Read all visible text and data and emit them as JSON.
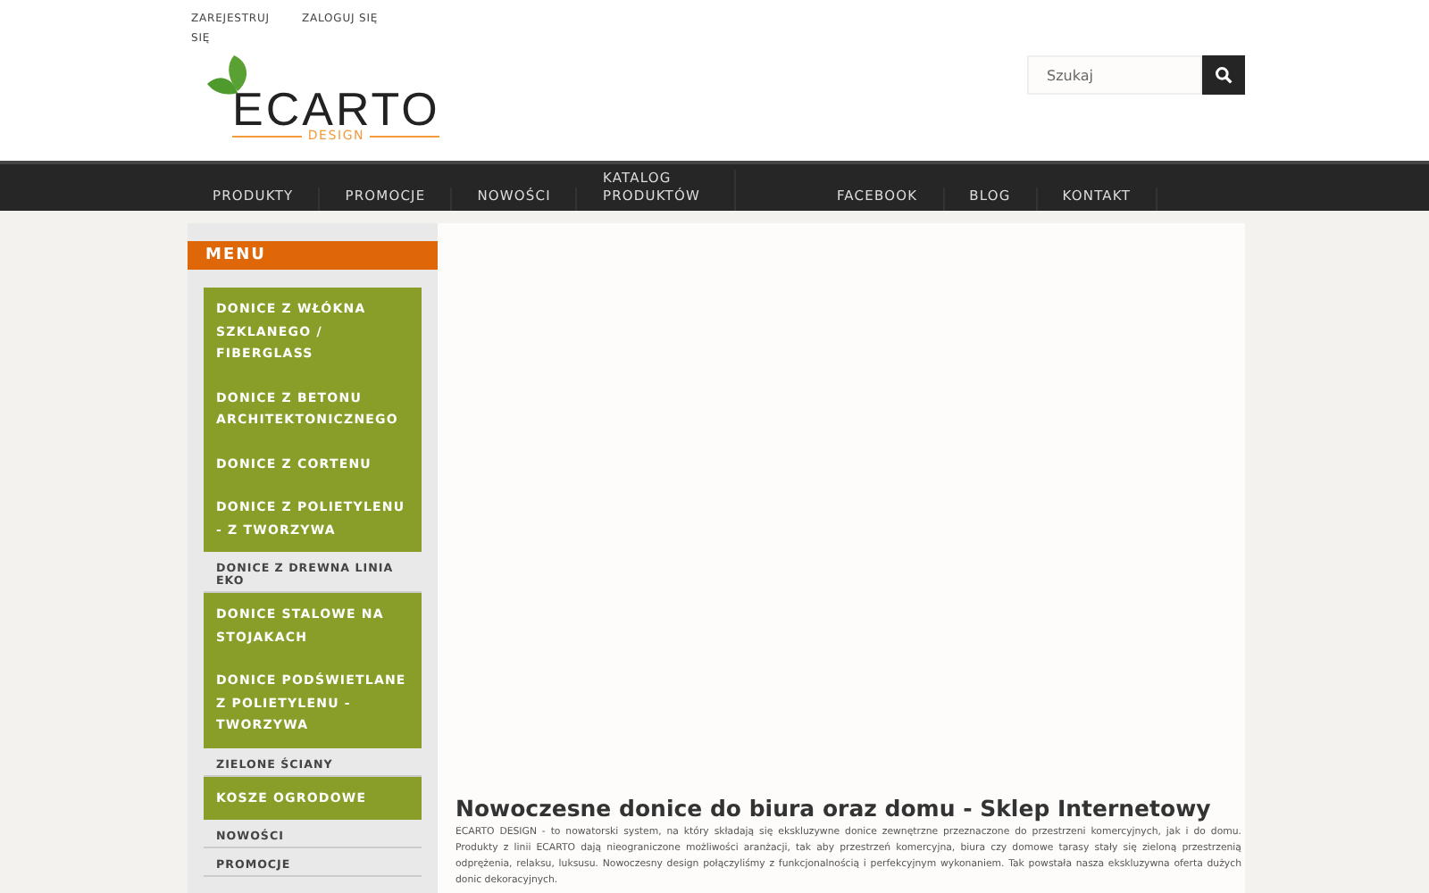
{
  "top_links": [
    "ZAREJESTRUJ SIĘ",
    "ZALOGUJ SIĘ"
  ],
  "logo": {
    "name": "ECARTO",
    "tagline": "DESIGN"
  },
  "search": {
    "placeholder": "Szukaj"
  },
  "nav": {
    "left": [
      "PRODUKTY",
      "PROMOCJE",
      "NOWOŚCI",
      "KATALOG PRODUKTÓW"
    ],
    "right": [
      "FACEBOOK",
      "BLOG",
      "KONTAKT"
    ]
  },
  "sidebar": {
    "title": "MENU",
    "items": [
      {
        "kind": "feature",
        "label": "DONICE Z WŁÓKNA SZKLANEGO / FIBERGLASS"
      },
      {
        "kind": "feature",
        "label": "DONICE Z BETONU ARCHITEKTONICZNEGO"
      },
      {
        "kind": "feature",
        "label": "DONICE Z CORTENU"
      },
      {
        "kind": "feature",
        "label": "DONICE Z POLIETYLENU - Z TWORZYWA"
      },
      {
        "kind": "plain",
        "label": "DONICE Z DREWNA LINIA EKO"
      },
      {
        "kind": "feature",
        "label": "DONICE STALOWE NA STOJAKACH"
      },
      {
        "kind": "feature",
        "label": "DONICE PODŚWIETLANE Z POLIETYLENU - TWORZYWA"
      },
      {
        "kind": "plain",
        "label": "ZIELONE ŚCIANY"
      },
      {
        "kind": "feature",
        "label": "KOSZE OGRODOWE"
      },
      {
        "kind": "plain",
        "label": "NOWOŚCI"
      },
      {
        "kind": "plain",
        "label": "PROMOCJE"
      }
    ]
  },
  "main": {
    "heading": "Nowoczesne donice do biura oraz domu - Sklep Internetowy",
    "intro": "ECARTO DESIGN - to nowatorski system, na który składają się ekskluzywne donice zewnętrzne przeznaczone do przestrzeni komercyjnych, jak i do domu. Produkty z linii ECARTO dają nieograniczone możliwości aranżacji, tak aby przestrzeń komercyjna, biura czy domowe tarasy stały się zieloną przestrzenią odprężenia, relaksu, luksusu. Nowoczesny design połączyliśmy z funkcjonalnością i perfekcyjnym wykonaniem. Tak powstała nasza ekskluzywna oferta dużych donic dekoracyjnych."
  }
}
